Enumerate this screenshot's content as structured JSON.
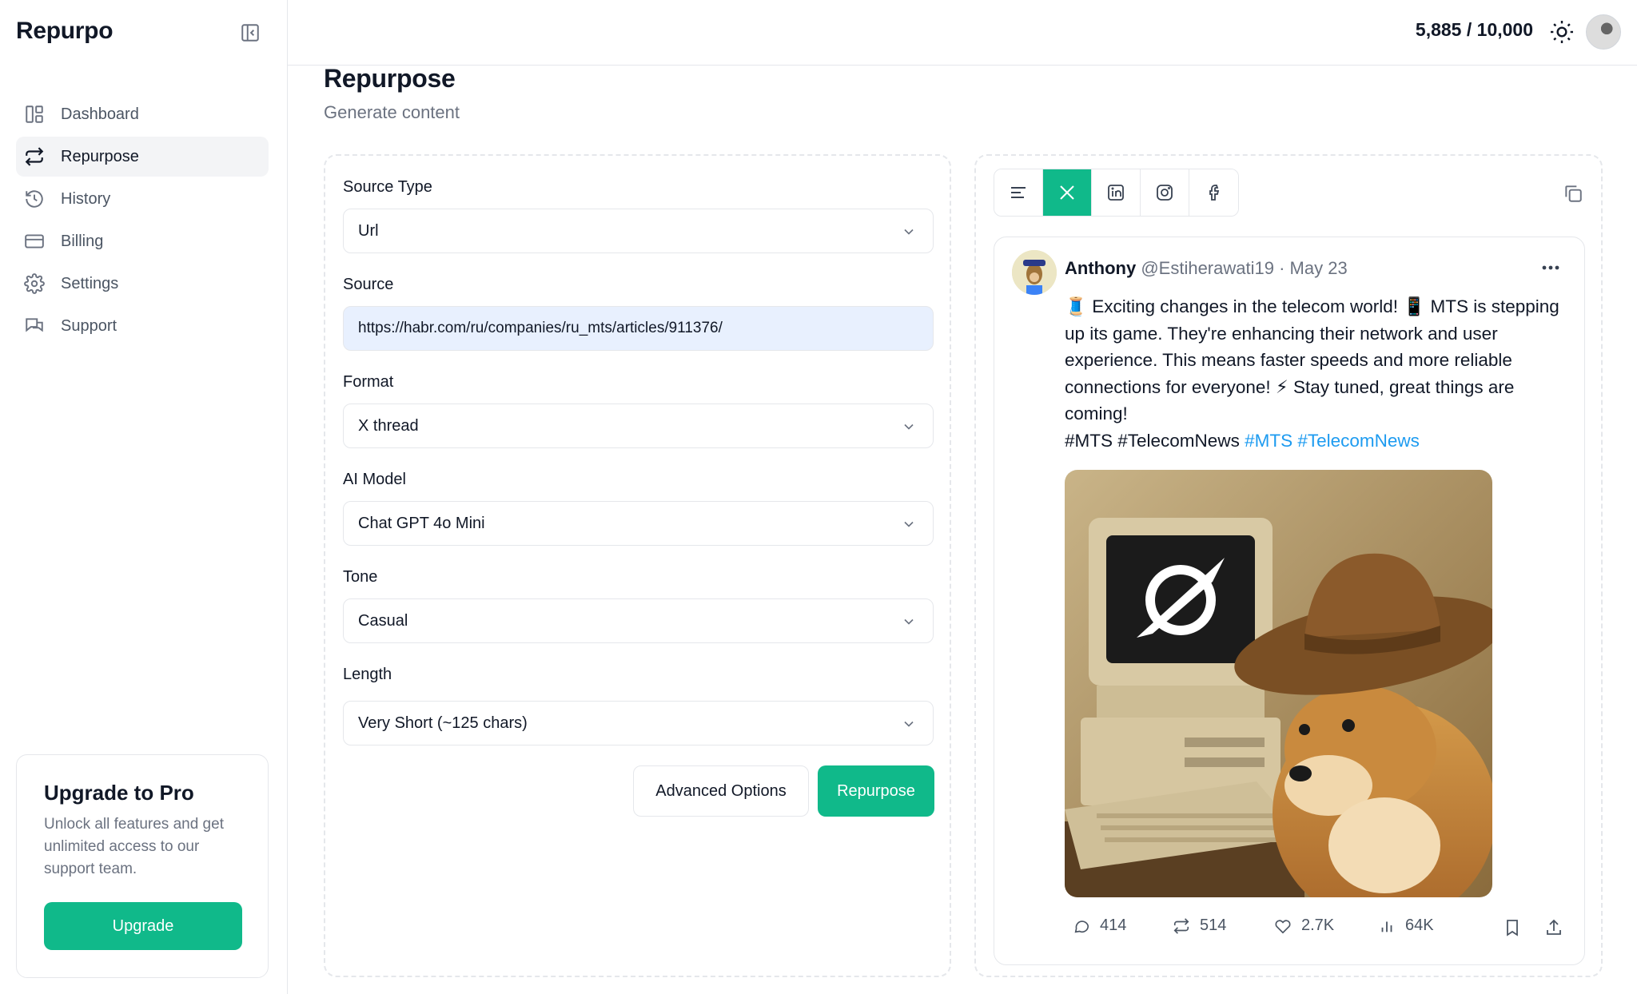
{
  "brand": "Repurpo",
  "sidebar": {
    "items": [
      {
        "label": "Dashboard",
        "icon": "dashboard-icon",
        "active": false
      },
      {
        "label": "Repurpose",
        "icon": "repurpose-icon",
        "active": true
      },
      {
        "label": "History",
        "icon": "history-icon",
        "active": false
      },
      {
        "label": "Billing",
        "icon": "credit-card-icon",
        "active": false
      },
      {
        "label": "Settings",
        "icon": "gear-icon",
        "active": false
      },
      {
        "label": "Support",
        "icon": "chat-bubbles-icon",
        "active": false
      }
    ],
    "upgrade": {
      "title": "Upgrade to Pro",
      "text": "Unlock all features and get unlimited access to our support team.",
      "button": "Upgrade"
    }
  },
  "header": {
    "credits": "5,885 / 10,000"
  },
  "page": {
    "title": "Repurpose",
    "subtitle": "Generate content"
  },
  "form": {
    "source_type": {
      "label": "Source Type",
      "value": "Url"
    },
    "source": {
      "label": "Source",
      "value": "https://habr.com/ru/companies/ru_mts/articles/911376/"
    },
    "format": {
      "label": "Format",
      "value": "X thread"
    },
    "ai_model": {
      "label": "AI Model",
      "value": "Chat GPT 4o Mini"
    },
    "tone": {
      "label": "Tone",
      "value": "Casual"
    },
    "length": {
      "label": "Length",
      "value": "Very Short (~125 chars)"
    },
    "advanced_button": "Advanced Options",
    "submit_button": "Repurpose"
  },
  "preview": {
    "tabs": [
      "text-lines-icon",
      "x-logo-icon",
      "linkedin-icon",
      "instagram-icon",
      "facebook-icon"
    ],
    "active_tab": "x-logo-icon",
    "tweet": {
      "name": "Anthony",
      "handle": "@Estiherawati19",
      "date": "· May 23",
      "body": "🧵 Exciting changes in the telecom world! 📱 MTS is stepping up its game. They're enhancing their network and user experience. This means faster speeds and more reliable connections for everyone! ⚡ Stay tuned, great things are coming!",
      "plain_tags": "#MTS #TelecomNews",
      "link_tags": [
        "#MTS",
        "#TelecomNews"
      ],
      "stats": {
        "replies": "414",
        "retweets": "514",
        "likes": "2.7K",
        "views": "64K"
      }
    }
  },
  "colors": {
    "accent": "#10b98a",
    "link": "#1d9bf0",
    "muted": "#6b7280"
  }
}
